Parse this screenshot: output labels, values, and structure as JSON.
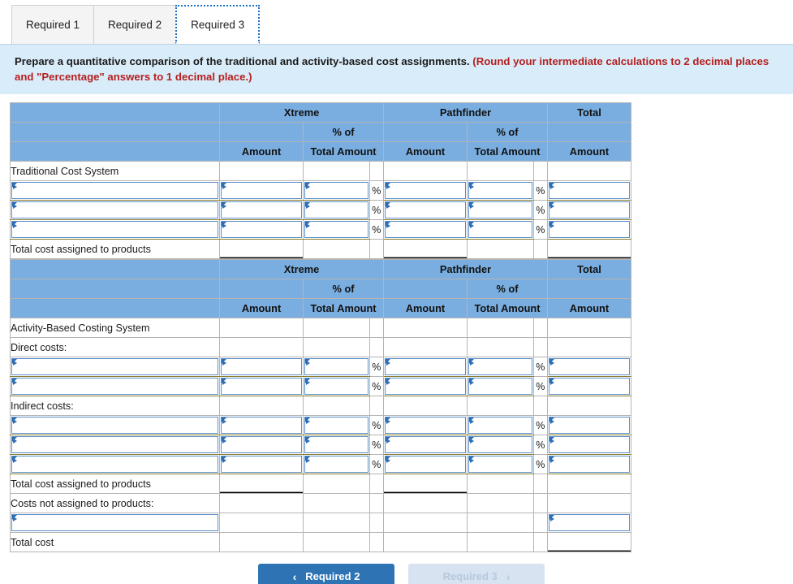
{
  "tabs": [
    {
      "label": "Required 1",
      "active": false
    },
    {
      "label": "Required 2",
      "active": false
    },
    {
      "label": "Required 3",
      "active": true
    }
  ],
  "instruction": {
    "main": "Prepare a quantitative comparison of the traditional and activity-based cost assignments.",
    "hint": "(Round your intermediate calculations to 2 decimal places and \"Percentage\" answers to 1 decimal place.)"
  },
  "headers": {
    "xtreme": "Xtreme",
    "pathfinder": "Pathfinder",
    "total": "Total",
    "pct_of": "% of",
    "amount": "Amount",
    "total_amount": "Total Amount",
    "percent_symbol": "%"
  },
  "table1": {
    "title_row": "Traditional Cost System",
    "input_rows": 3,
    "total_row": "Total cost assigned to products"
  },
  "table2": {
    "title_row": "Activity-Based Costing System",
    "direct_label": "Direct costs:",
    "direct_rows": 2,
    "indirect_label": "Indirect costs:",
    "indirect_rows": 3,
    "total_assigned_row": "Total cost assigned to products",
    "not_assigned_label": "Costs not assigned to products:",
    "not_assigned_rows": 1,
    "total_cost_row": "Total cost"
  },
  "nav": {
    "prev_label": "Required 2",
    "next_label": "Required 3",
    "prev_chevron": "‹",
    "next_chevron": "›"
  },
  "colors": {
    "header_blue": "#7aaee0",
    "banner_blue": "#d9ecf9",
    "hint_red": "#b51f1f",
    "button_blue": "#2e74b5",
    "button_disabled": "#d7e3f0",
    "input_border": "#5b8fc9"
  }
}
